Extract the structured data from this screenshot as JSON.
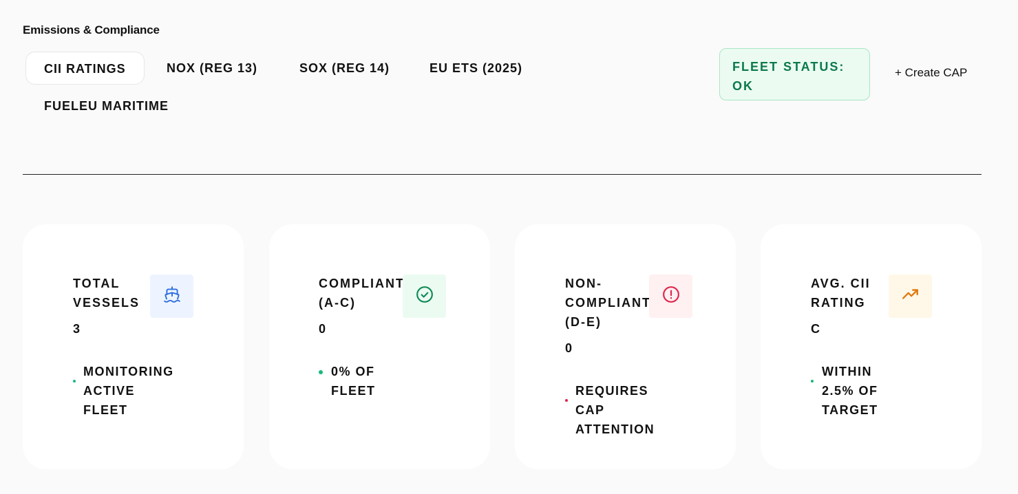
{
  "header": {
    "title": "Emissions & Compliance"
  },
  "tabs": [
    {
      "label": "CII RATINGS",
      "active": true
    },
    {
      "label": "NOX (REG 13)",
      "active": false
    },
    {
      "label": "SOX (REG 14)",
      "active": false
    },
    {
      "label": "EU ETS (2025)",
      "active": false
    },
    {
      "label": "FUELEU MARITIME",
      "active": false
    }
  ],
  "fleet_status": {
    "label": "FLEET STATUS:\nOK"
  },
  "actions": {
    "create_cap": "+ Create CAP"
  },
  "cards": [
    {
      "label": "TOTAL\nVESSELS",
      "value": "3",
      "note": "MONITORING\nACTIVE FLEET",
      "icon": "ship-icon",
      "icon_color": "#2f6fe0",
      "icon_bg": "#eef4ff",
      "dot_color": "#18b97a"
    },
    {
      "label": "COMPLIANT\n(A-C)",
      "value": "0",
      "note": "0% OF FLEET",
      "icon": "check-circle-icon",
      "icon_color": "#0f8a55",
      "icon_bg": "#ebfbf2",
      "dot_color": "#18b97a"
    },
    {
      "label": "NON-\nCOMPLIANT\n(D-E)",
      "value": "0",
      "note": "REQUIRES CAP\nATTENTION",
      "icon": "alert-circle-icon",
      "icon_color": "#e0264a",
      "icon_bg": "#fff0f2",
      "dot_color": "#e0264a"
    },
    {
      "label": "AVG. CII\nRATING",
      "value": "C",
      "note": "WITHIN 2.5% OF\nTARGET",
      "icon": "trending-up-icon",
      "icon_color": "#e07a10",
      "icon_bg": "#fff8e8",
      "dot_color": "#18b97a"
    }
  ]
}
